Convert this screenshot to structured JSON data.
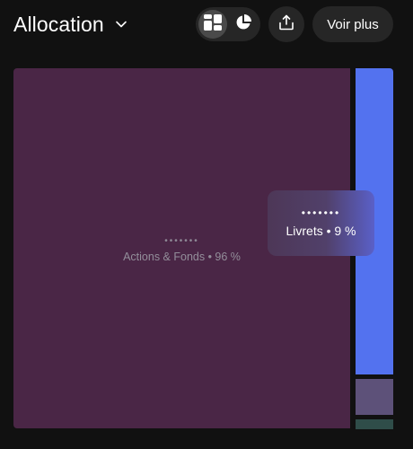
{
  "header": {
    "title": "Allocation",
    "view_toggle": {
      "selected": "treemap",
      "options": [
        "treemap-icon",
        "pie-chart-icon"
      ]
    },
    "share_icon": "share-icon",
    "more_label": "Voir plus"
  },
  "treemap": {
    "tiles": [
      {
        "name": "Actions & Fonds",
        "amount_masked": "•••••••",
        "label": "Actions & Fonds • 96 %",
        "percent": 96,
        "color": "#4a2646"
      },
      {
        "name": "Livrets",
        "amount_masked": "•••••••",
        "label": "Livrets • 9 %",
        "percent": 9,
        "color": "#5372ef"
      },
      {
        "color": "#5d5179"
      },
      {
        "color": "#2f4d49"
      }
    ]
  }
}
